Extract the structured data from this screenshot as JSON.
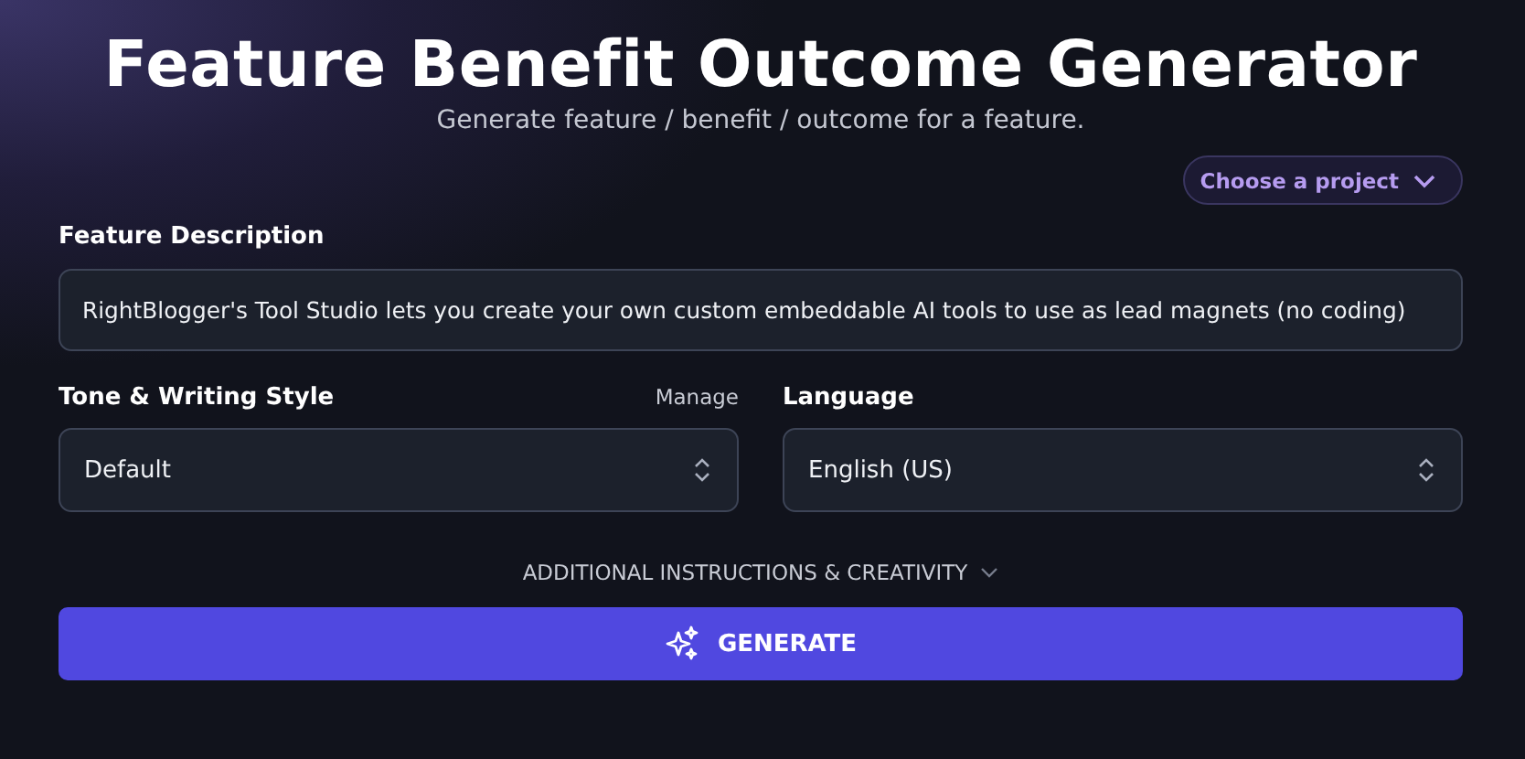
{
  "header": {
    "title": "Feature Benefit Outcome Generator",
    "subtitle": "Generate feature / benefit / outcome for a feature."
  },
  "project_picker": {
    "label": "Choose a project"
  },
  "feature_description": {
    "label": "Feature Description",
    "value": "RightBlogger's Tool Studio lets you create your own custom embeddable AI tools to use as lead magnets (no coding)"
  },
  "selects": [
    {
      "label": "Tone & Writing Style",
      "action": "Manage",
      "value": "Default"
    },
    {
      "label": "Language",
      "value": "English (US)"
    }
  ],
  "additional": {
    "label": "ADDITIONAL INSTRUCTIONS & CREATIVITY"
  },
  "generate_button": {
    "label": "GENERATE"
  }
}
